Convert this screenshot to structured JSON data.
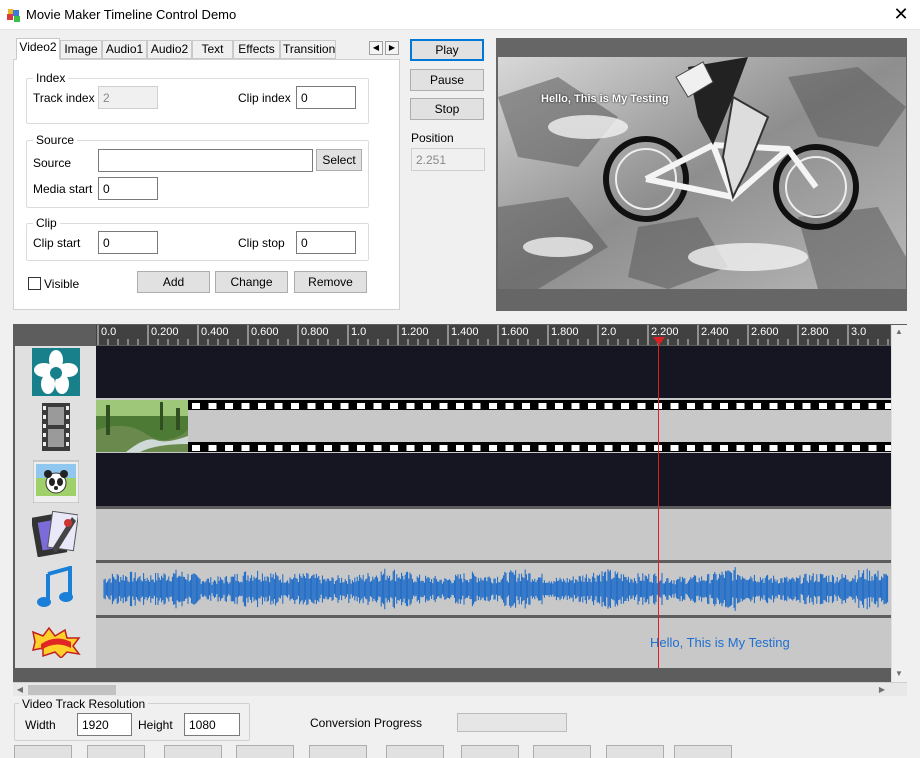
{
  "window": {
    "title": "Movie Maker Timeline Control Demo",
    "close_glyph": "✕"
  },
  "tabs": [
    {
      "label": "Video2",
      "active": true
    },
    {
      "label": "Image"
    },
    {
      "label": "Audio1"
    },
    {
      "label": "Audio2"
    },
    {
      "label": "Text"
    },
    {
      "label": "Effects"
    },
    {
      "label": "Transition"
    }
  ],
  "tab_scroll": {
    "left": "◀",
    "right": "▶"
  },
  "index_group": {
    "title": "Index",
    "track_index_label": "Track index",
    "track_index_value": "2",
    "clip_index_label": "Clip index",
    "clip_index_value": "0"
  },
  "source_group": {
    "title": "Source",
    "source_label": "Source",
    "source_value": "",
    "select_label": "Select",
    "media_start_label": "Media start",
    "media_start_value": "0"
  },
  "clip_group": {
    "title": "Clip",
    "clip_start_label": "Clip start",
    "clip_start_value": "0",
    "clip_stop_label": "Clip stop",
    "clip_stop_value": "0"
  },
  "visible_label": "Visible",
  "visible_checked": false,
  "actions": {
    "add": "Add",
    "change": "Change",
    "remove": "Remove"
  },
  "playback": {
    "play": "Play",
    "pause": "Pause",
    "stop": "Stop",
    "position_label": "Position",
    "position_value": "2.251"
  },
  "preview": {
    "caption": "Hello, This is My Testing"
  },
  "timeline": {
    "ruler_labels": [
      "0.0",
      "0.200",
      "0.400",
      "0.600",
      "0.800",
      "1.0",
      "1.200",
      "1.400",
      "1.600",
      "1.800",
      "2.0",
      "2.200",
      "2.400",
      "2.600",
      "2.800",
      "3.0"
    ],
    "playhead_position": 2.251,
    "text_clip": "Hello, This is My Testing",
    "track_icons": [
      "pinwheel-icon",
      "film-strip-icon",
      "panda-picture-icon",
      "video-editor-icon",
      "music-note-icon",
      "comic-text-icon"
    ]
  },
  "resolution": {
    "title": "Video Track Resolution",
    "width_label": "Width",
    "width_value": "1920",
    "height_label": "Height",
    "height_value": "1080"
  },
  "conversion": {
    "label": "Conversion Progress",
    "progress": 0
  },
  "colors": {
    "accent": "#0078d7",
    "waveform": "#1466c8",
    "playhead": "#e02020",
    "track_dark": "#161622",
    "track_light": "#c8c8c8"
  }
}
